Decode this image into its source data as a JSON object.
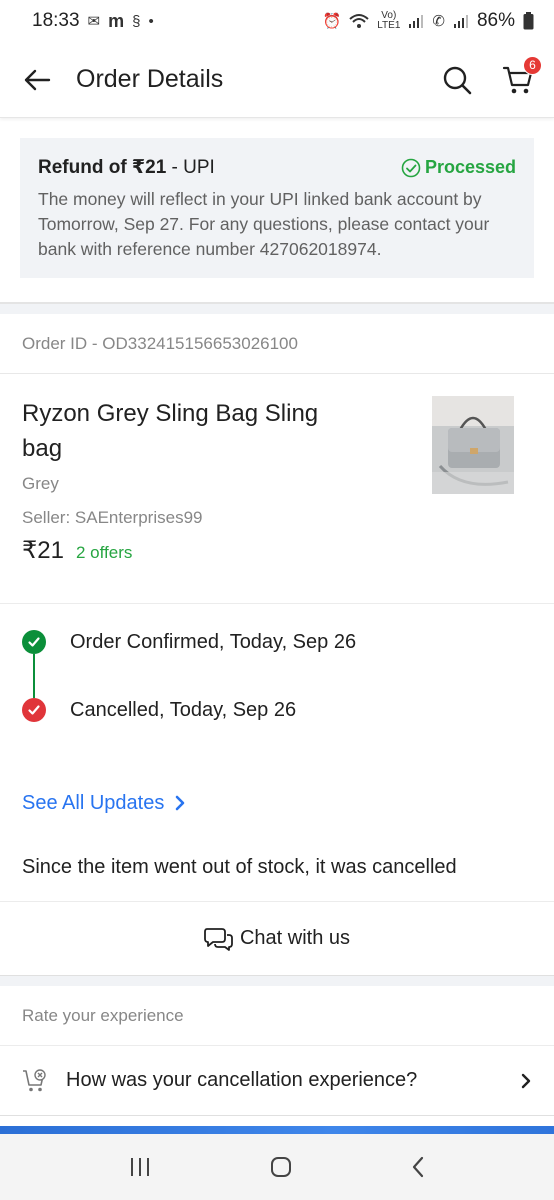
{
  "status_bar": {
    "time": "18:33",
    "battery": "86%"
  },
  "header": {
    "title": "Order Details",
    "cart_count": "6"
  },
  "refund": {
    "title_bold": "Refund of ₹21",
    "title_suffix": " - UPI",
    "status": "Processed",
    "message": "The money will reflect in your UPI linked bank account by Tomorrow, Sep 27. For any questions, please contact your bank with reference number 427062018974."
  },
  "order": {
    "order_id": "Order ID - OD332415156653026100"
  },
  "product": {
    "name": "Ryzon Grey Sling Bag Sling bag",
    "color": "Grey",
    "seller": "Seller: SAEnterprises99",
    "price": "₹21",
    "offers": "2 offers"
  },
  "timeline": [
    {
      "label": "Order Confirmed, Today, Sep 26",
      "state": "done"
    },
    {
      "label": "Cancelled, Today, Sep 26",
      "state": "cancelled"
    }
  ],
  "see_all_updates": "See All Updates",
  "cancel_reason": "Since the item went out of stock, it was cancelled",
  "chat": "Chat with us",
  "rating": {
    "heading": "Rate your experience",
    "question": "How was your cancellation experience?"
  },
  "colors": {
    "green": "#26a541",
    "red": "#e0353a",
    "link_blue": "#2874f0"
  }
}
